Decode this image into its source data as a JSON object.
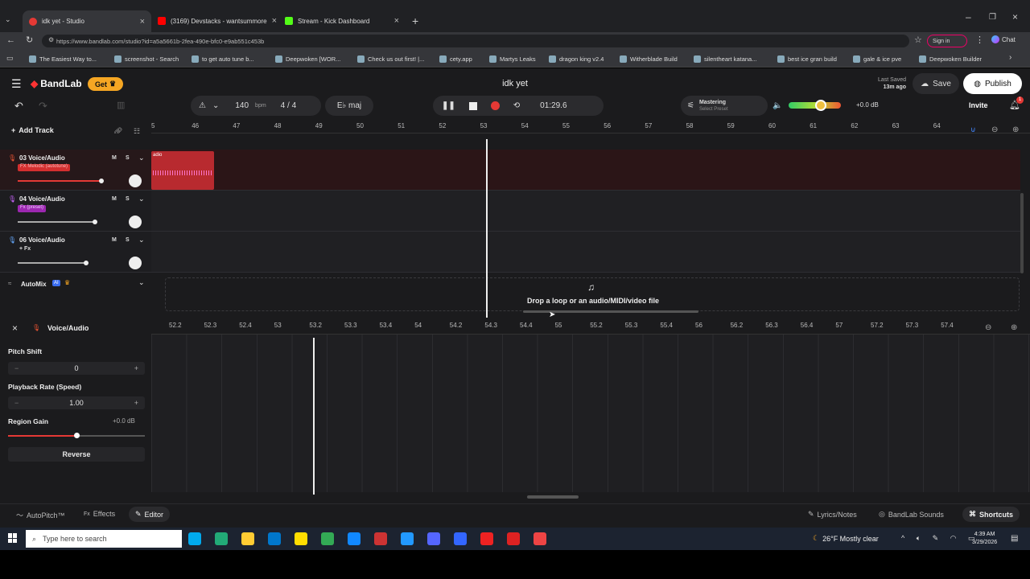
{
  "browser": {
    "tabs": [
      {
        "title": "idk yet - Studio",
        "color": "#e53935"
      },
      {
        "title": "(3169) Devstacks - wantsummore",
        "color": "#ff0000"
      },
      {
        "title": "Stream - Kick Dashboard",
        "color": "#53fc18"
      }
    ],
    "url": "https://www.bandlab.com/studio?id=a5a5661b-2fea-490e-bfc0-e9ab551c453b",
    "sign_in": "Sign in",
    "chat": "Chat",
    "bookmarks": [
      "The Easiest Way to...",
      "screenshot - Search",
      "to get auto tune b...",
      "Deepwoken [WOR...",
      "Check us out first! |...",
      "cety.app",
      "Martys Leaks",
      "dragon king v2.4",
      "Witherblade Build",
      "silentheart katana...",
      "best ice gran build",
      "gale & ice pve",
      "Deepwoken Builder"
    ]
  },
  "app": {
    "logo": "BandLab",
    "get_label": "Get",
    "project_title": "idk yet",
    "last_saved_label": "Last Saved",
    "last_saved_time": "13m ago",
    "save_label": "Save",
    "publish_label": "Publish",
    "invite_label": "Invite",
    "notification_count": "1"
  },
  "toolbar": {
    "bpm_value": "140",
    "bpm_unit": "bpm",
    "time_signature": "4 / 4",
    "key": "E♭ maj",
    "time_display": "01:29.6",
    "mastering_label": "Mastering",
    "mastering_preset": "Select Preset",
    "volume_db": "+0.0 dB",
    "volume_level": 0.42
  },
  "timeline": {
    "add_track": "Add Track",
    "ticks": [
      "5",
      "46",
      "47",
      "48",
      "49",
      "50",
      "51",
      "52",
      "53",
      "54",
      "55",
      "56",
      "57",
      "58",
      "59",
      "60",
      "61",
      "62",
      "63",
      "64"
    ]
  },
  "tracks": [
    {
      "name": "03 Voice/Audio",
      "tag": "FX Melodic (autotune)",
      "tag_color": "#d32f2f",
      "m": "M",
      "s": "S"
    },
    {
      "name": "04 Voice/Audio",
      "tag": "Fx (preset)",
      "tag_color": "#9c27b0",
      "m": "M",
      "s": "S"
    },
    {
      "name": "06 Voice/Audio",
      "tag": "+ Fx",
      "tag_color": "",
      "m": "M",
      "s": "S"
    }
  ],
  "automix": {
    "label": "AutoMix",
    "badge": "AI"
  },
  "drop_text": "Drop a loop or an audio/MIDI/video file",
  "region_label": "adio",
  "editor": {
    "title": "Voice/Audio",
    "pitch_shift_label": "Pitch Shift",
    "pitch_shift_value": "0",
    "minus": "−",
    "plus": "+",
    "playback_rate_label": "Playback Rate (Speed)",
    "playback_rate_value": "1.00",
    "region_gain_label": "Region Gain",
    "region_gain_value": "+0.0 dB",
    "region_gain_level": 0.5,
    "reverse_label": "Reverse",
    "ticks": [
      "52.2",
      "52.3",
      "52.4",
      "53",
      "53.2",
      "53.3",
      "53.4",
      "54",
      "54.2",
      "54.3",
      "54.4",
      "55",
      "55.2",
      "55.3",
      "55.4",
      "56",
      "56.2",
      "56.3",
      "56.4",
      "57",
      "57.2",
      "57.3",
      "57.4"
    ]
  },
  "footer": {
    "autopitch": "AutoPitch™",
    "effects": "Effects",
    "editor": "Editor",
    "lyrics": "Lyrics/Notes",
    "sounds": "BandLab Sounds",
    "shortcuts": "Shortcuts"
  },
  "taskbar": {
    "search_placeholder": "Type here to search",
    "weather": "26°F  Mostly clear",
    "time": "4:39 AM",
    "date": "3/29/2026"
  }
}
